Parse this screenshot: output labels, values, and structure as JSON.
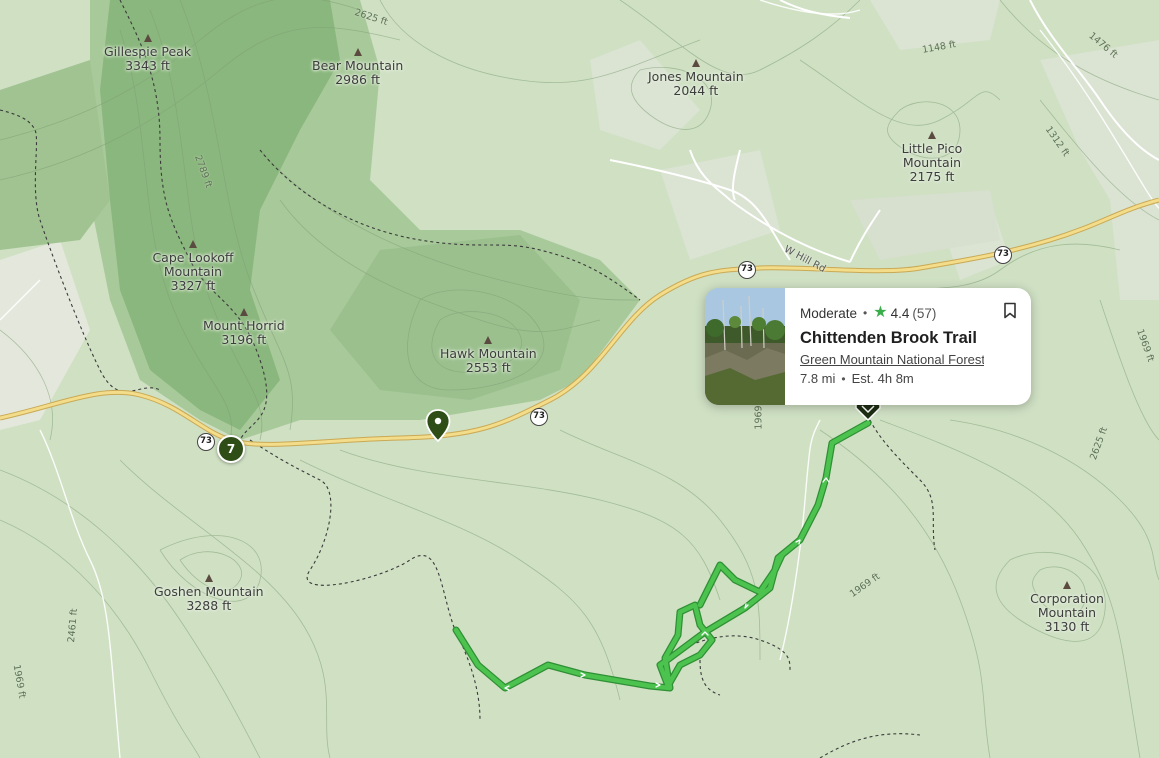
{
  "map": {
    "colors": {
      "background": "#cfe0c3",
      "dense_forest": "#8ab77d",
      "forest": "#a8c99a",
      "clearing": "#dbe3d3",
      "highway": "#e8c96a",
      "trail": "#4cc34f",
      "marker": "#2f4d17"
    },
    "peaks": [
      {
        "name": "Gillespie Peak",
        "elevation": "3343 ft"
      },
      {
        "name": "Bear Mountain",
        "elevation": "2986 ft"
      },
      {
        "name": "Jones Mountain",
        "elevation": "2044 ft"
      },
      {
        "name": "Little Pico Mountain",
        "elevation": "2175 ft"
      },
      {
        "name": "Cape Lookoff Mountain",
        "elevation": "3327 ft"
      },
      {
        "name": "Mount Horrid",
        "elevation": "3196 ft"
      },
      {
        "name": "Hawk Mountain",
        "elevation": "2553 ft"
      },
      {
        "name": "Goshen Mountain",
        "elevation": "3288 ft"
      },
      {
        "name": "Corporation Mountain",
        "elevation": "3130 ft"
      }
    ],
    "route_number": "73",
    "road_name": "W Hill Rd",
    "contour_labels": [
      "2625 ft",
      "1148 ft",
      "1476 ft",
      "1312 ft",
      "2789 ft",
      "1969",
      "2625 ft",
      "1969 ft",
      "1969 ft",
      "2461 ft",
      "1969 ft"
    ],
    "cluster_count": "7",
    "icons": {
      "peak": "peak-triangle-icon",
      "pin": "map-pin-icon",
      "trailhead": "trailhead-marker-icon"
    }
  },
  "trail_card": {
    "difficulty": "Moderate",
    "rating": "4.4",
    "review_count": "(57)",
    "name": "Chittenden Brook Trail",
    "park": "Green Mountain National Forest",
    "length": "7.8 mi",
    "estimate": "Est. 4h 8m",
    "icons": {
      "star": "star-icon",
      "bookmark": "bookmark-icon",
      "photo": "trail-photo"
    }
  }
}
